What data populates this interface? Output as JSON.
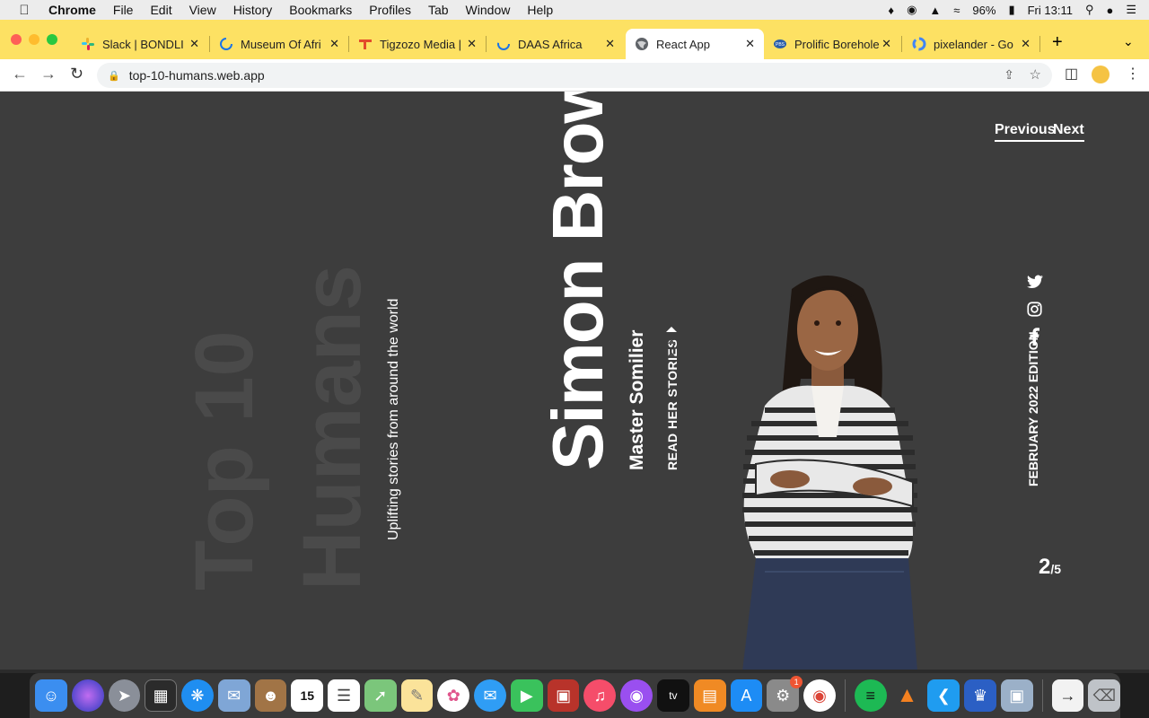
{
  "menubar": {
    "app_name": "Chrome",
    "items": [
      "File",
      "Edit",
      "View",
      "History",
      "Bookmarks",
      "Profiles",
      "Tab",
      "Window",
      "Help"
    ],
    "battery": "96%",
    "clock": "Fri 13:11"
  },
  "tabs": [
    {
      "title": "Slack | BONDLI",
      "favicon": "slack-icon"
    },
    {
      "title": "Museum Of Afri",
      "favicon": "loading-spinner-icon"
    },
    {
      "title": "Tigzozo Media |",
      "favicon": "tigzozo-icon"
    },
    {
      "title": "DAAS Africa",
      "favicon": "loading-spinner-icon"
    },
    {
      "title": "React App",
      "favicon": "globe-icon",
      "active": true
    },
    {
      "title": "Prolific Borehole",
      "favicon": "prolific-icon"
    },
    {
      "title": "pixelander - Go",
      "favicon": "google-icon"
    }
  ],
  "omnibox": {
    "url": "top-10-humans.web.app"
  },
  "page": {
    "site_title": "Top 10 Humans",
    "tagline": "Uplifting stories from around the world",
    "person_name": "Simon Brown",
    "person_role": "Master Somilier",
    "cta": "READ HER STORIES",
    "edition": "FEBRUARY 2022 EDITION",
    "nav_previous": "Previous",
    "nav_next": "Next",
    "counter_current": "2",
    "counter_total": "/5",
    "social_icons": [
      "twitter-icon",
      "instagram-icon",
      "facebook-icon"
    ]
  },
  "dock": {
    "calendar_day": "15",
    "appstore_badge": "1"
  },
  "colors": {
    "page_bg": "#3d3d3d",
    "tabstrip": "#fde163",
    "big_title": "#4a4a4a"
  }
}
